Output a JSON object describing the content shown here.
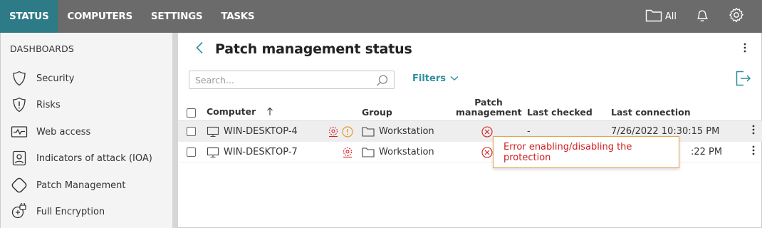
{
  "topbar": {
    "tabs": [
      {
        "label": "STATUS",
        "active": true
      },
      {
        "label": "COMPUTERS",
        "active": false
      },
      {
        "label": "SETTINGS",
        "active": false
      },
      {
        "label": "TASKS",
        "active": false
      }
    ],
    "folder_label": "All",
    "icons": [
      "folder-icon",
      "bell-icon",
      "gear-icon"
    ],
    "colors": {
      "bar": "#6b6b6b",
      "active_tab": "#2d7b86"
    }
  },
  "sidebar": {
    "heading": "DASHBOARDS",
    "items": [
      {
        "label": "Security",
        "icon": "shield-icon"
      },
      {
        "label": "Risks",
        "icon": "risk-shield-icon"
      },
      {
        "label": "Web access",
        "icon": "web-access-icon"
      },
      {
        "label": "Indicators of attack (IOA)",
        "icon": "ioa-icon"
      },
      {
        "label": "Patch Management",
        "icon": "patch-icon"
      },
      {
        "label": "Full Encryption",
        "icon": "encryption-icon"
      }
    ]
  },
  "main": {
    "title": "Patch management status",
    "search_placeholder": "Search...",
    "filters_label": "Filters",
    "columns": {
      "computer": "Computer",
      "group": "Group",
      "patch_line1": "Patch",
      "patch_line2": "management",
      "last_checked": "Last checked",
      "last_connection": "Last connection"
    },
    "sort_column": "computer",
    "rows": [
      {
        "computer": "WIN-DESKTOP-4",
        "group": "Workstation",
        "patch_status": "error",
        "last_checked": "-",
        "last_connection": "7/26/2022 10:30:15 PM",
        "warning": true
      },
      {
        "computer": "WIN-DESKTOP-7",
        "group": "Workstation",
        "patch_status": "error",
        "last_checked": "",
        "last_connection": ":22 PM",
        "warning": false
      }
    ],
    "tooltip": "Error enabling/disabling the protection",
    "colors": {
      "accent": "#2d8fa0",
      "error": "#d02020",
      "warning": "#e69a2c"
    }
  }
}
